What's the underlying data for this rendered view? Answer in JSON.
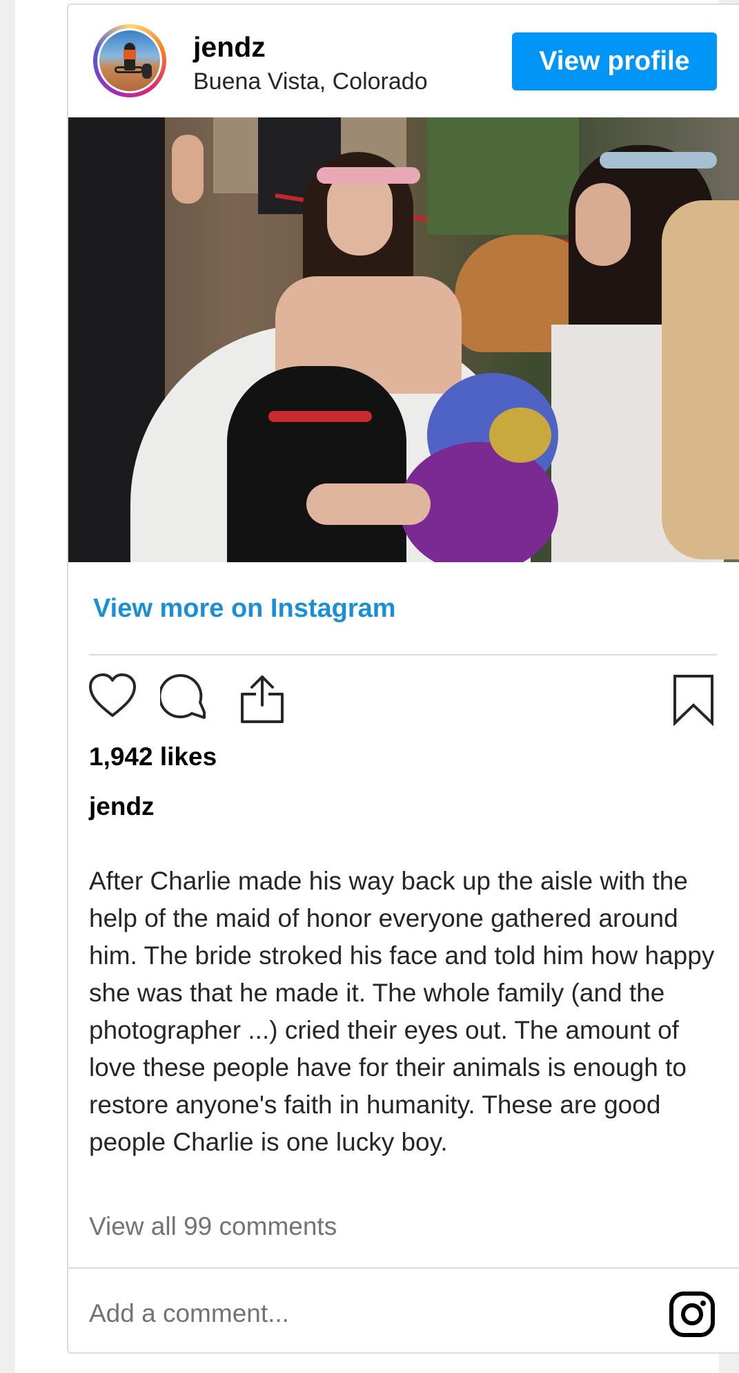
{
  "post": {
    "username": "jendz",
    "location": "Buena Vista, Colorado",
    "view_profile_label": "View profile",
    "view_more_label": "View more on Instagram",
    "likes": "1,942 likes",
    "caption_username": "jendz",
    "caption_text": "After Charlie made his way back up the aisle with the help of the maid of honor everyone gathered around him. The bride stroked his face and told him how happy she was that he made it. The whole family (and the photographer ...) cried their eyes out. The amount of love these people have for their animals is enough to restore anyone's faith in humanity. These are good people Charlie is one lucky boy.",
    "view_all_comments": "View all 99 comments",
    "add_comment_placeholder": "Add a comment..."
  },
  "icons": {
    "like": "heart-icon",
    "comment": "comment-icon",
    "share": "share-icon",
    "save": "bookmark-icon",
    "brand": "instagram-icon"
  },
  "colors": {
    "accent": "#0095f6",
    "link": "#1b8fd6",
    "muted": "#737373",
    "border": "#dbdbdb"
  }
}
